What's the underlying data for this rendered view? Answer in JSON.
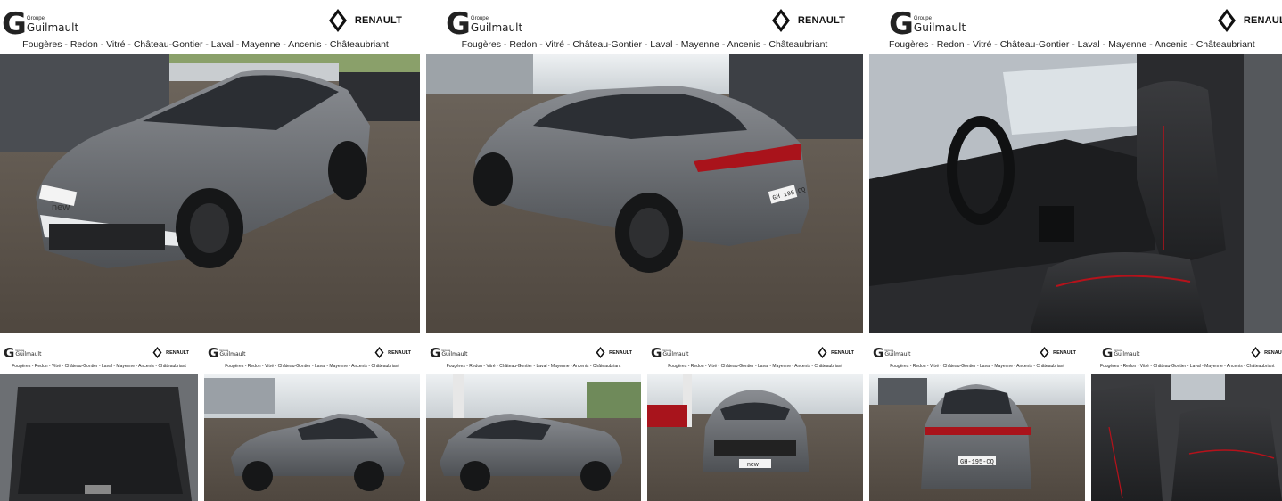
{
  "dealer": {
    "group_small": "Groupe",
    "group_name": "Guilmault",
    "brand": "RENAULT",
    "locations": "Fougères - Redon - Vitré - Château-Gontier - Laval - Mayenne - Ancenis - Châteaubriant"
  },
  "vehicle": {
    "hood_badge": "new",
    "plate": "GH-195-CQ",
    "plate_short": "GH 195 CQ"
  },
  "gallery": {
    "photos": [
      {
        "subject": "front three-quarter exterior"
      },
      {
        "subject": "rear three-quarter exterior"
      },
      {
        "subject": "front cabin interior"
      },
      {
        "subject": "boot / trunk"
      },
      {
        "subject": "left side profile"
      },
      {
        "subject": "right side profile"
      },
      {
        "subject": "front view"
      },
      {
        "subject": "rear view"
      },
      {
        "subject": "rear seats"
      }
    ]
  },
  "colors": {
    "car_body": "#6b6e73",
    "asphalt": "#5e554b",
    "sky": "#dfe3e6",
    "accent_red": "#b5121b"
  }
}
